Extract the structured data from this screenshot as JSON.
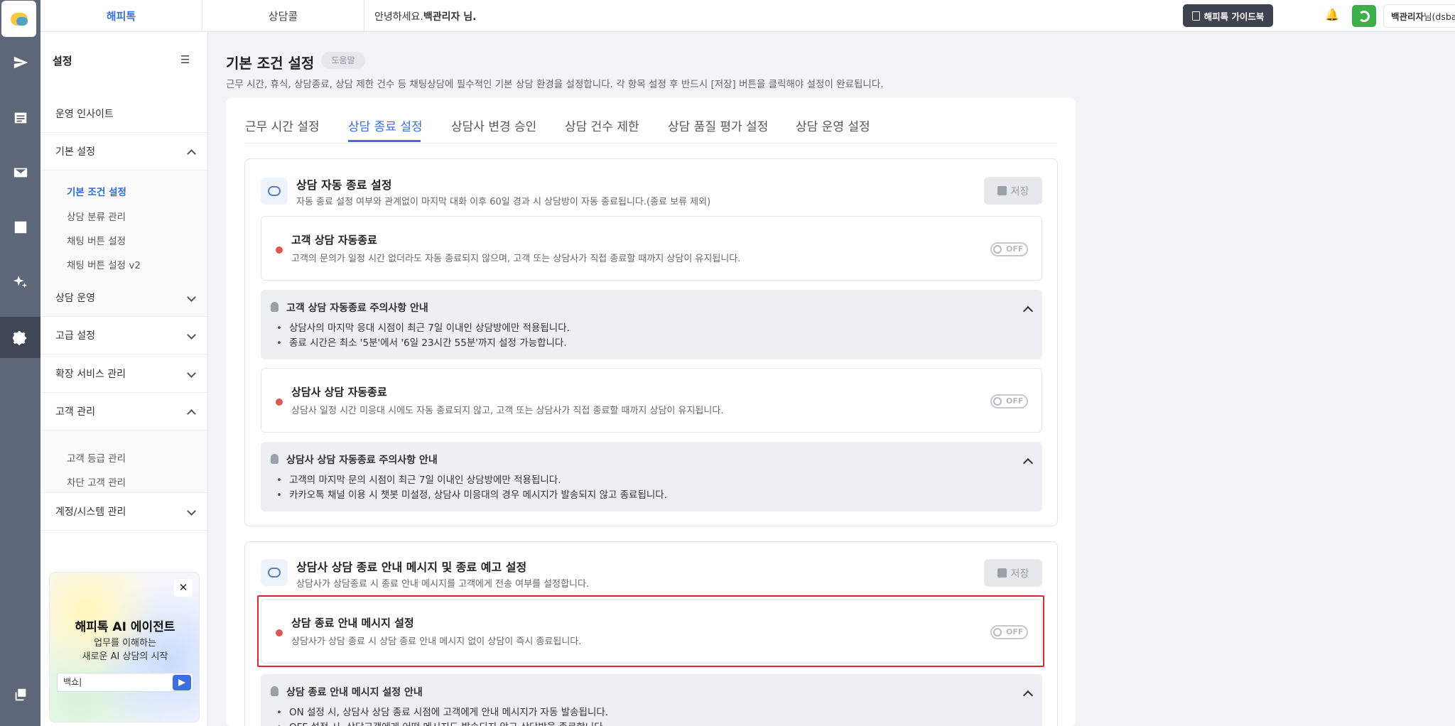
{
  "header": {
    "tabs": [
      "해피톡",
      "상담콜"
    ],
    "greeting_prefix": "안녕하세요.",
    "greeting_name": "백관리자 님.",
    "guide_button": "해피톡 가이드북",
    "user_name": "백관리자",
    "user_suffix": "님(dsbaek)"
  },
  "rail": {
    "icons": [
      "send-icon",
      "list-icon",
      "mail-icon",
      "chart-icon",
      "sparkle-icon",
      "gear-icon",
      "copy-icon"
    ]
  },
  "sidebar": {
    "title": "설정",
    "items": [
      {
        "label": "운영 인사이트"
      },
      {
        "label": "기본 설정"
      },
      {
        "label": "상담 운영"
      },
      {
        "label": "고급 설정"
      },
      {
        "label": "확장 서비스 관리"
      },
      {
        "label": "고객 관리"
      },
      {
        "label": "계정/시스템 관리"
      }
    ],
    "basic_sub": [
      "기본 조건 설정",
      "상담 분류 관리",
      "채팅 버튼 설정",
      "채팅 버튼 설정 v2"
    ],
    "customer_sub": [
      "고객 등급 관리",
      "차단 고객 관리"
    ]
  },
  "ai_card": {
    "close": "✕",
    "title": "해피톡 AI 에이전트",
    "line1": "업무를 이해하는",
    "line2": "새로운 AI 상담의 시작",
    "input_value": "백쇼|"
  },
  "page": {
    "title": "기본 조건 설정",
    "help": "도움말",
    "desc": "근무 시간, 휴식, 상담종료, 상담 제한 건수 등 채팅상담에 필수적인 기본 상담 환경을 설정합니다. 각 항목 설정 후 반드시 [저장] 버튼을 클릭해야 설정이 완료됩니다."
  },
  "tabs": [
    "근무 시간 설정",
    "상담 종료 설정",
    "상담사 변경 승인",
    "상담 건수 제한",
    "상담 품질 평가 설정",
    "상담 운영 설정"
  ],
  "section1": {
    "title": "상담 자동 종료 설정",
    "desc": "자동 종료 설정 여부와 관계없이 마지막 대화 이후 60일 경과 시 상담방이 자동 종료됩니다.(종료 보류 제외)",
    "save": "저장",
    "row1": {
      "title": "고객 상담 자동종료",
      "desc": "고객의 문의가 일정 시간 없더라도 자동 종료되지 않으며, 고객 또는 상담사가 직접 종료할 때까지 상담이 유지됩니다.",
      "toggle": "OFF"
    },
    "notice1": {
      "title": "고객 상담 자동종료 주의사항 안내",
      "items": [
        "상담사의 마지막 응대 시점이 최근 7일 이내인 상담방에만 적용됩니다.",
        "종료 시간은 최소 '5분'에서 '6일 23시간 55분'까지 설정 가능합니다."
      ]
    },
    "row2": {
      "title": "상담사 상담 자동종료",
      "desc": "상담사 일정 시간 미응대 시에도 자동 종료되지 않고, 고객 또는 상담사가 직접 종료할 때까지 상담이 유지됩니다.",
      "toggle": "OFF"
    },
    "notice2": {
      "title": "상담사 상담 자동종료 주의사항 안내",
      "items": [
        "고객의 마지막 문의 시점이 최근 7일 이내인 상담방에만 적용됩니다.",
        "카카오톡 채널 이용 시 챗봇 미설정, 상담사 미응대의 경우 메시지가 발송되지 않고 종료됩니다."
      ]
    }
  },
  "section2": {
    "title": "상담사 상담 종료 안내 메시지 및 종료 예고 설정",
    "desc": "상담사가 상담종료 시 종료 안내 메시지를 고객에게 전송 여부를 설정합니다.",
    "save": "저장",
    "row1": {
      "title": "상담 종료 안내 메시지 설정",
      "desc": "상담사가 상담 종료 시 상담 종료 안내 메시지 없이 상담이 즉시 종료됩니다.",
      "toggle": "OFF"
    },
    "notice1": {
      "title": "상담 종료 안내 메시지 설정 안내",
      "items": [
        "ON 설정 시, 상담사 상담 종료 시점에 고객에게 안내 메시지가 자동 발송됩니다.",
        "OFF 설정 시, 상담고객에게 어떤 메시지도 발송되지 않고 상담방을 종료합니다."
      ]
    }
  }
}
